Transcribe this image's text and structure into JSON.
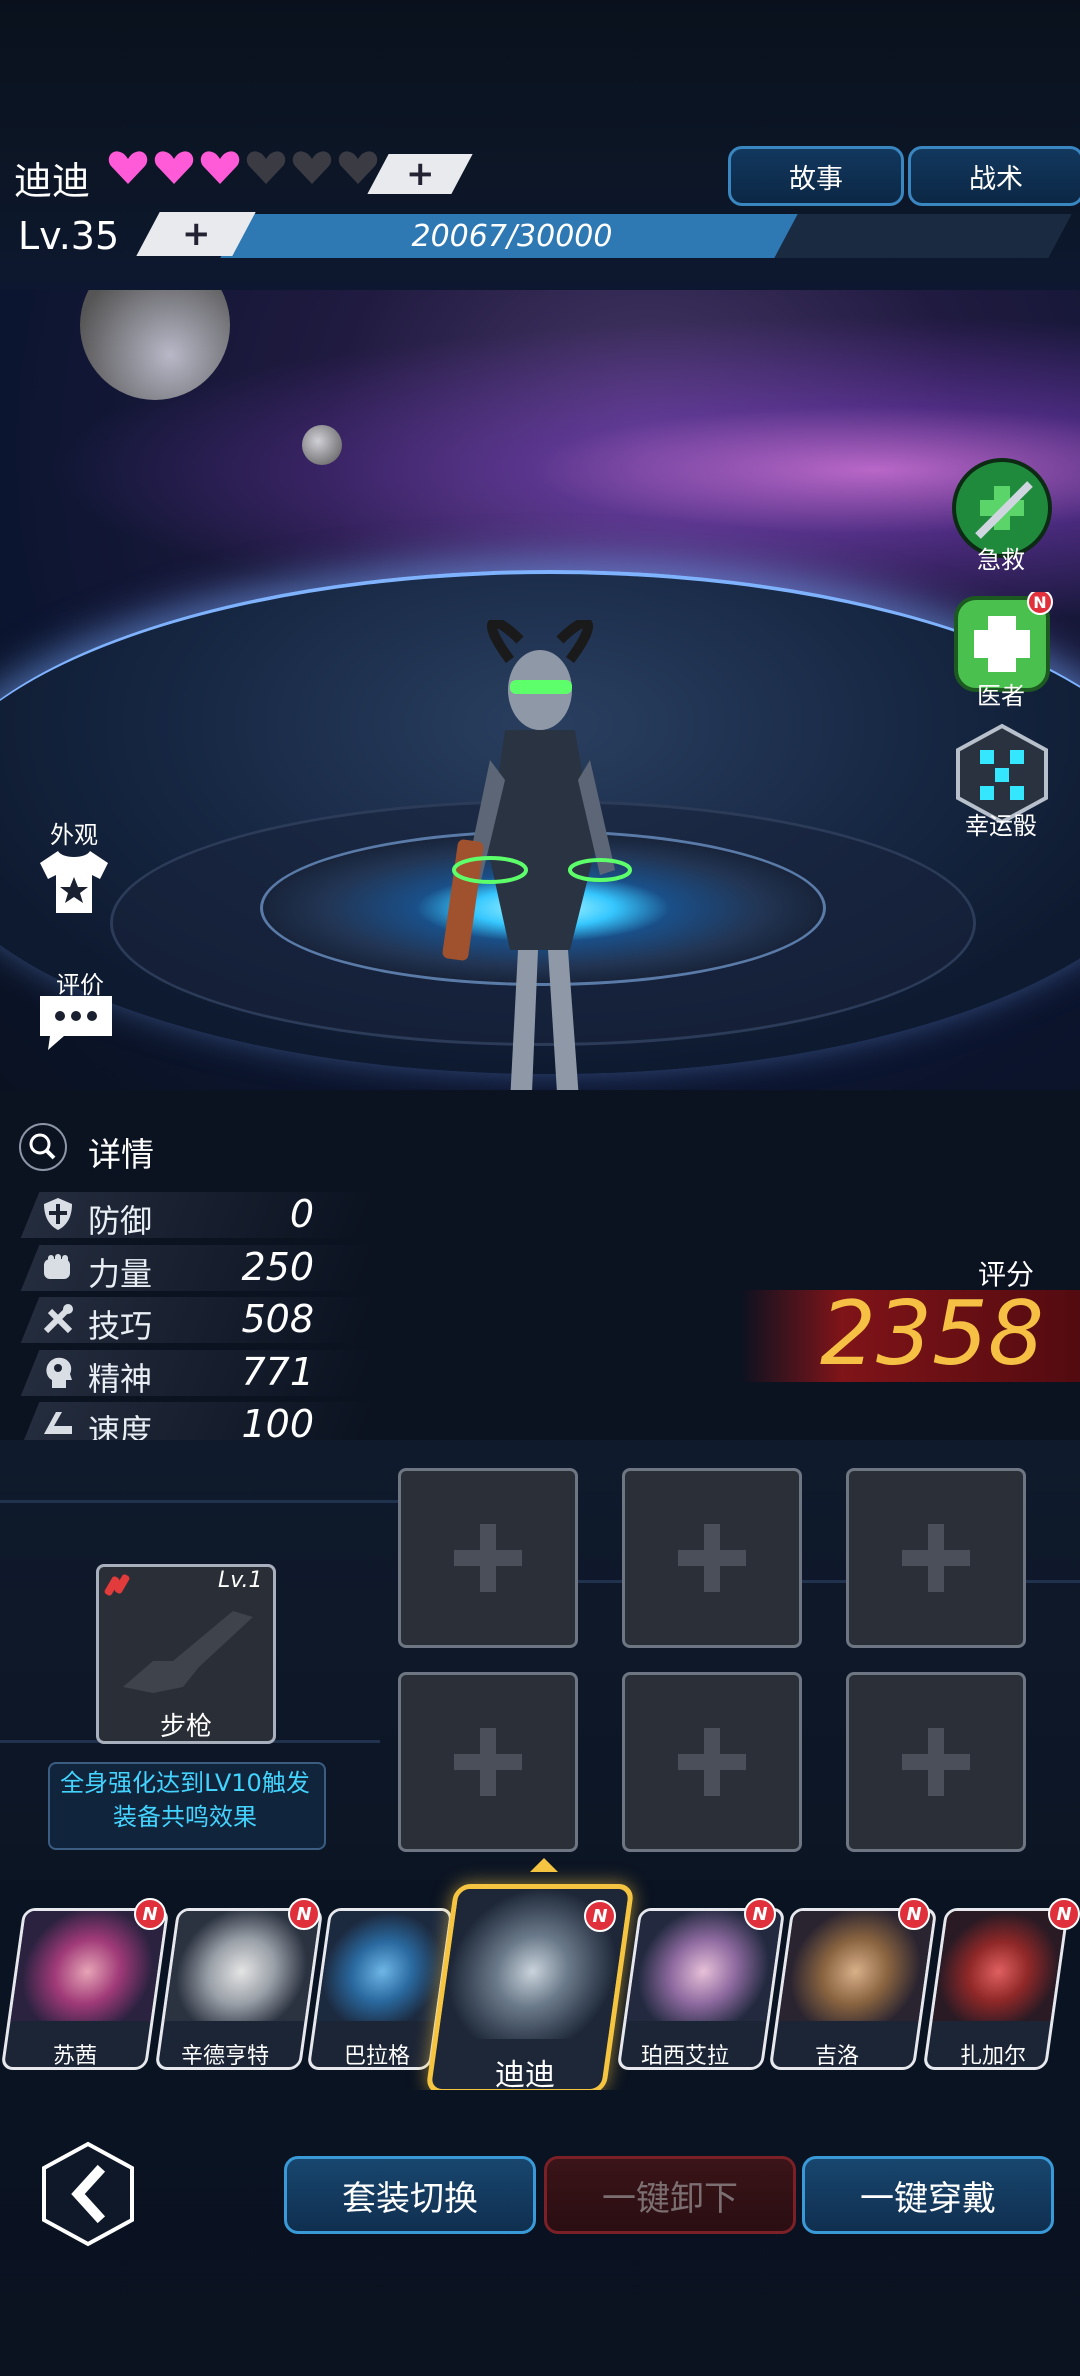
{
  "hero": {
    "name": "迪迪",
    "hearts_filled": 3,
    "hearts_total": 6,
    "level": "Lv.35",
    "exp_text": "20067/30000",
    "exp_current": 20067,
    "exp_max": 30000
  },
  "tabs": {
    "story": "故事",
    "tactics": "战术"
  },
  "side_buttons": {
    "first_aid": "急救",
    "doctor": "医者",
    "lucky_dice": "幸运骰"
  },
  "left_buttons": {
    "appearance": "外观",
    "review": "评价"
  },
  "details": {
    "label": "详情",
    "stats": [
      {
        "name": "防御",
        "value": "0",
        "icon": "shield-icon"
      },
      {
        "name": "力量",
        "value": "250",
        "icon": "fist-icon"
      },
      {
        "name": "技巧",
        "value": "508",
        "icon": "tools-icon"
      },
      {
        "name": "精神",
        "value": "771",
        "icon": "mind-icon"
      },
      {
        "name": "速度",
        "value": "100",
        "icon": "speed-icon"
      }
    ]
  },
  "score": {
    "label": "评分",
    "value": "2358"
  },
  "weapon": {
    "level": "Lv.1",
    "name": "步枪"
  },
  "tip": {
    "line1": "全身强化达到LV10触发",
    "line2": "装备共鸣效果"
  },
  "roster": [
    {
      "name": "苏茜",
      "badge": "N"
    },
    {
      "name": "辛德亨特",
      "badge": "N"
    },
    {
      "name": "巴拉格",
      "badge": "N"
    },
    {
      "name": "迪迪",
      "badge": "N",
      "active": true
    },
    {
      "name": "珀西艾拉",
      "badge": "N"
    },
    {
      "name": "吉洛",
      "badge": "N"
    },
    {
      "name": "扎加尔",
      "badge": "N"
    }
  ],
  "bottom": {
    "suit_switch": "套装切换",
    "unequip_all": "一键卸下",
    "equip_all": "一键穿戴"
  },
  "colors": {
    "accent": "#3a9ad8",
    "score": "#f6c045",
    "heart": "#ff5bd8",
    "badge": "#e0303c",
    "tip": "#43d3ff"
  }
}
